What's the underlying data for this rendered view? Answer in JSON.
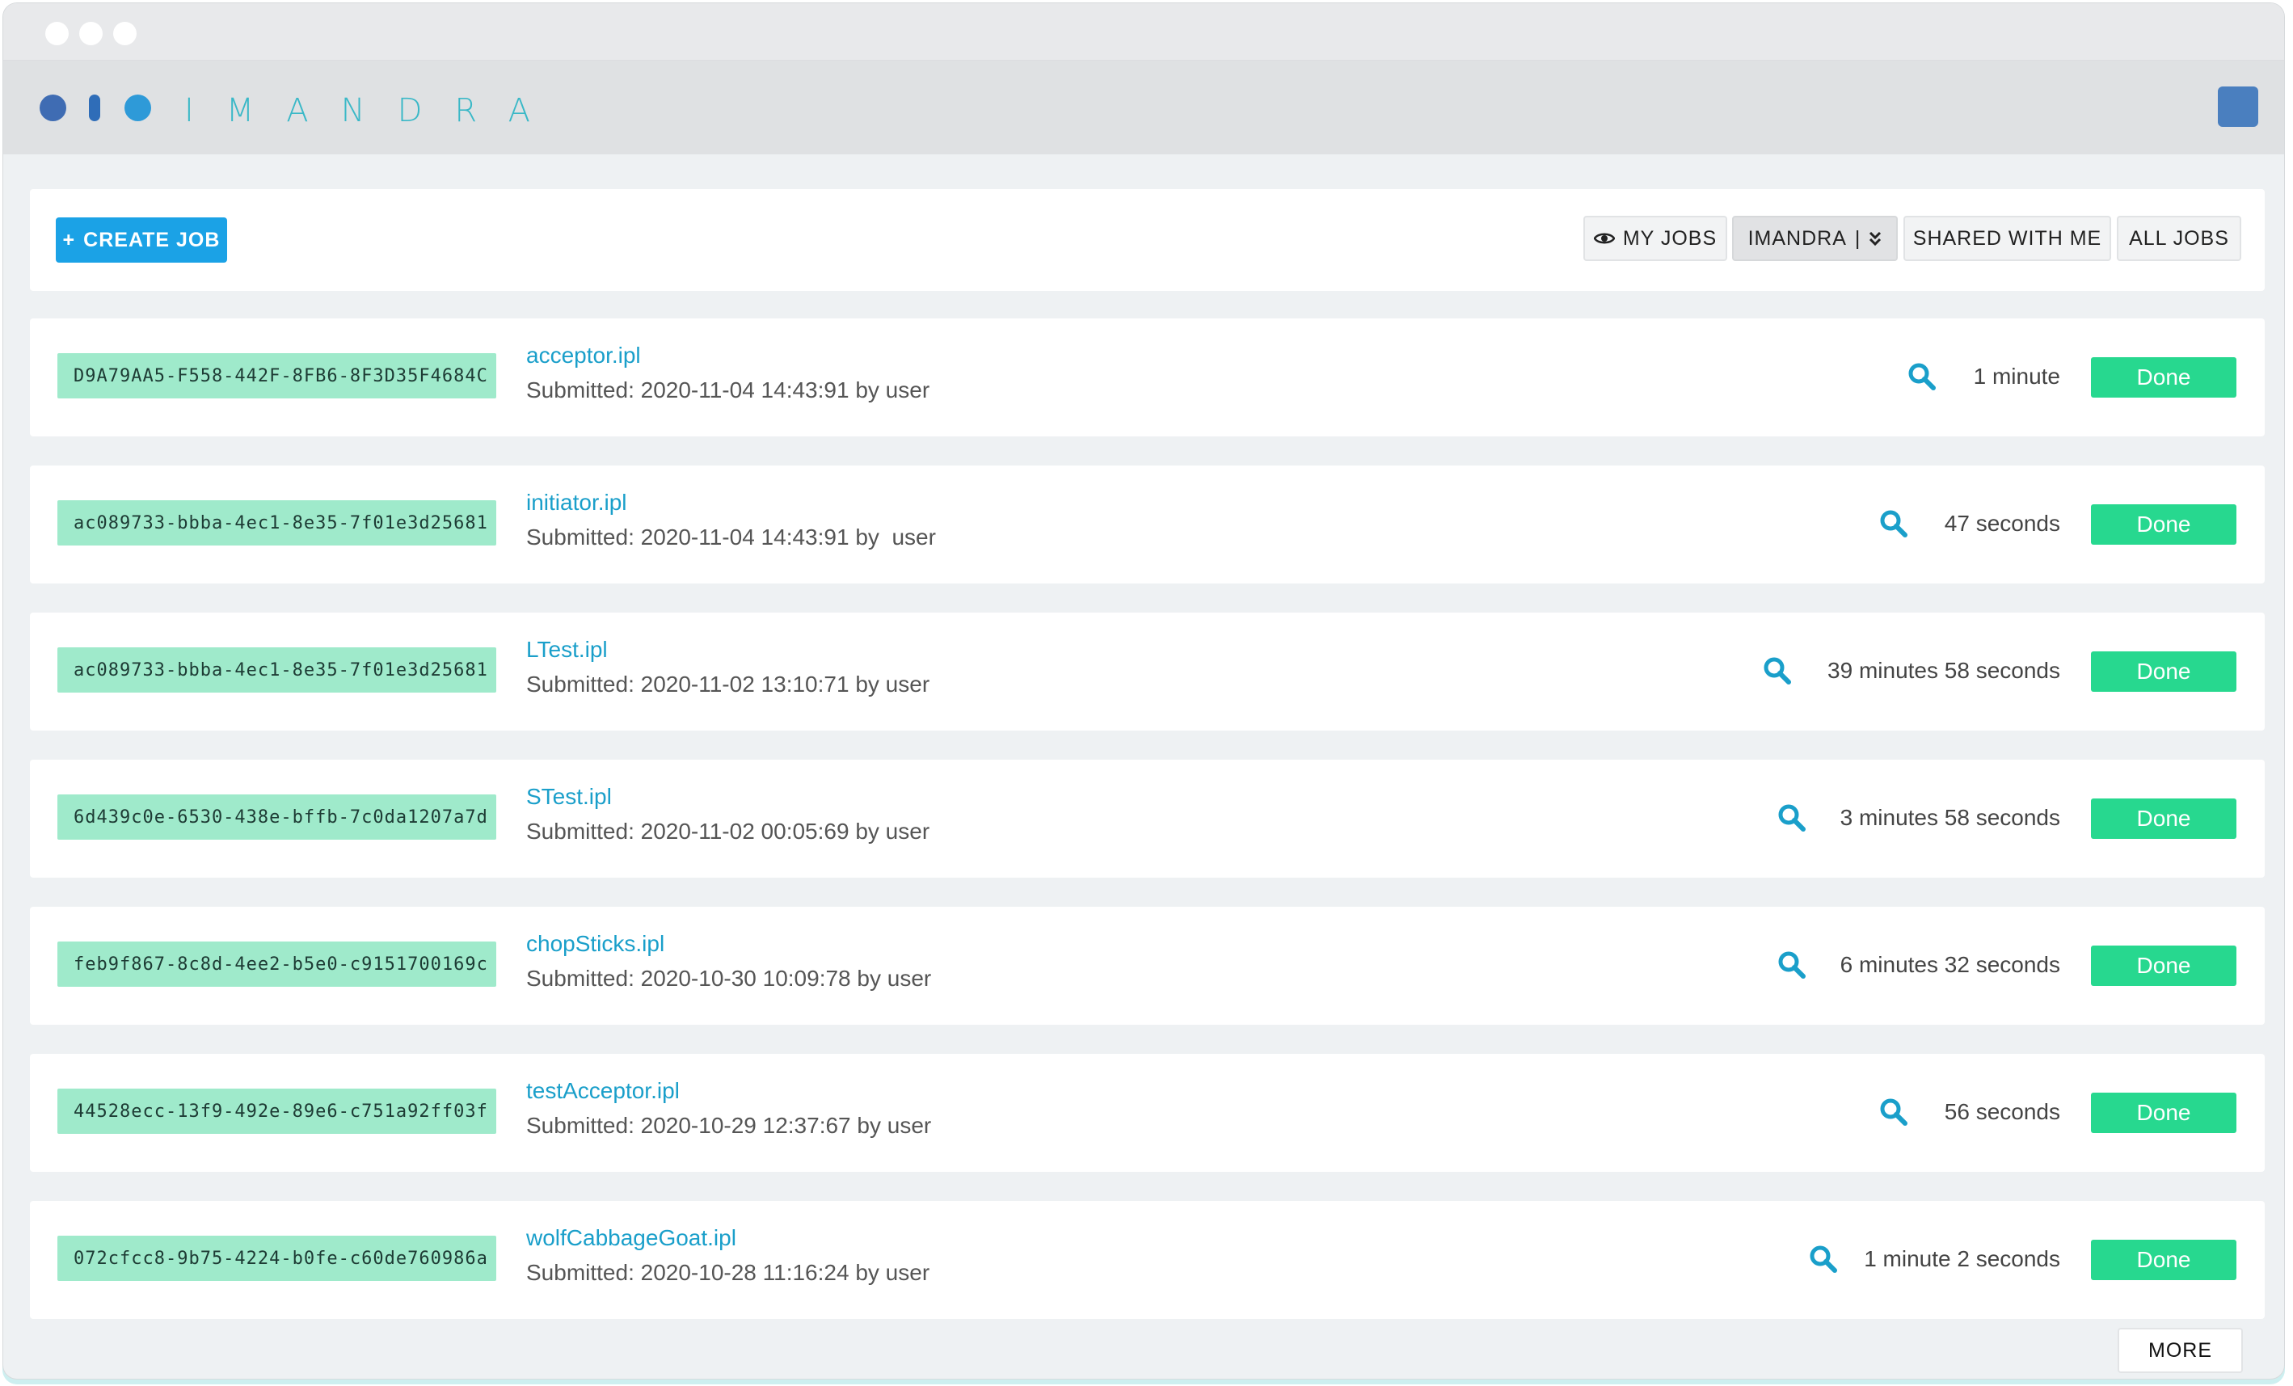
{
  "app": {
    "brand": "IMANDRA"
  },
  "toolbar": {
    "create_label": "CREATE JOB",
    "filters": {
      "my_jobs": "MY JOBS",
      "org": "IMANDRA",
      "shared": "SHARED WITH ME",
      "all": "ALL JOBS"
    }
  },
  "jobs": [
    {
      "id": "D9A79AA5-F558-442F-8FB6-8F3D35F4684C",
      "name": "acceptor.ipl",
      "submitted": "Submitted: 2020-11-04 14:43:91 by user",
      "duration": "1 minute",
      "status": "Done"
    },
    {
      "id": "ac089733-bbba-4ec1-8e35-7f01e3d25681",
      "name": "initiator.ipl",
      "submitted": "Submitted: 2020-11-04 14:43:91 by  user",
      "duration": "47 seconds",
      "status": "Done"
    },
    {
      "id": "ac089733-bbba-4ec1-8e35-7f01e3d25681",
      "name": "LTest.ipl",
      "submitted": "Submitted: 2020-11-02 13:10:71 by user",
      "duration": "39 minutes 58 seconds",
      "status": "Done"
    },
    {
      "id": "6d439c0e-6530-438e-bffb-7c0da1207a7d",
      "name": "STest.ipl",
      "submitted": "Submitted: 2020-11-02 00:05:69 by user",
      "duration": "3 minutes 58 seconds",
      "status": "Done"
    },
    {
      "id": "feb9f867-8c8d-4ee2-b5e0-c9151700169c",
      "name": "chopSticks.ipl",
      "submitted": "Submitted: 2020-10-30 10:09:78 by user",
      "duration": "6 minutes 32 seconds",
      "status": "Done"
    },
    {
      "id": "44528ecc-13f9-492e-89e6-c751a92ff03f",
      "name": "testAcceptor.ipl",
      "submitted": "Submitted: 2020-10-29 12:37:67 by user",
      "duration": "56 seconds",
      "status": "Done"
    },
    {
      "id": "072cfcc8-9b75-4224-b0fe-c60de760986a",
      "name": "wolfCabbageGoat.ipl",
      "submitted": "Submitted: 2020-10-28 11:16:24 by user",
      "duration": "1 minute 2 seconds",
      "status": "Done"
    }
  ],
  "more_label": "MORE",
  "colors": {
    "accent": "#1ba2e6",
    "done": "#27d88f",
    "id_bg": "#9feacb",
    "link": "#1a9fca"
  }
}
